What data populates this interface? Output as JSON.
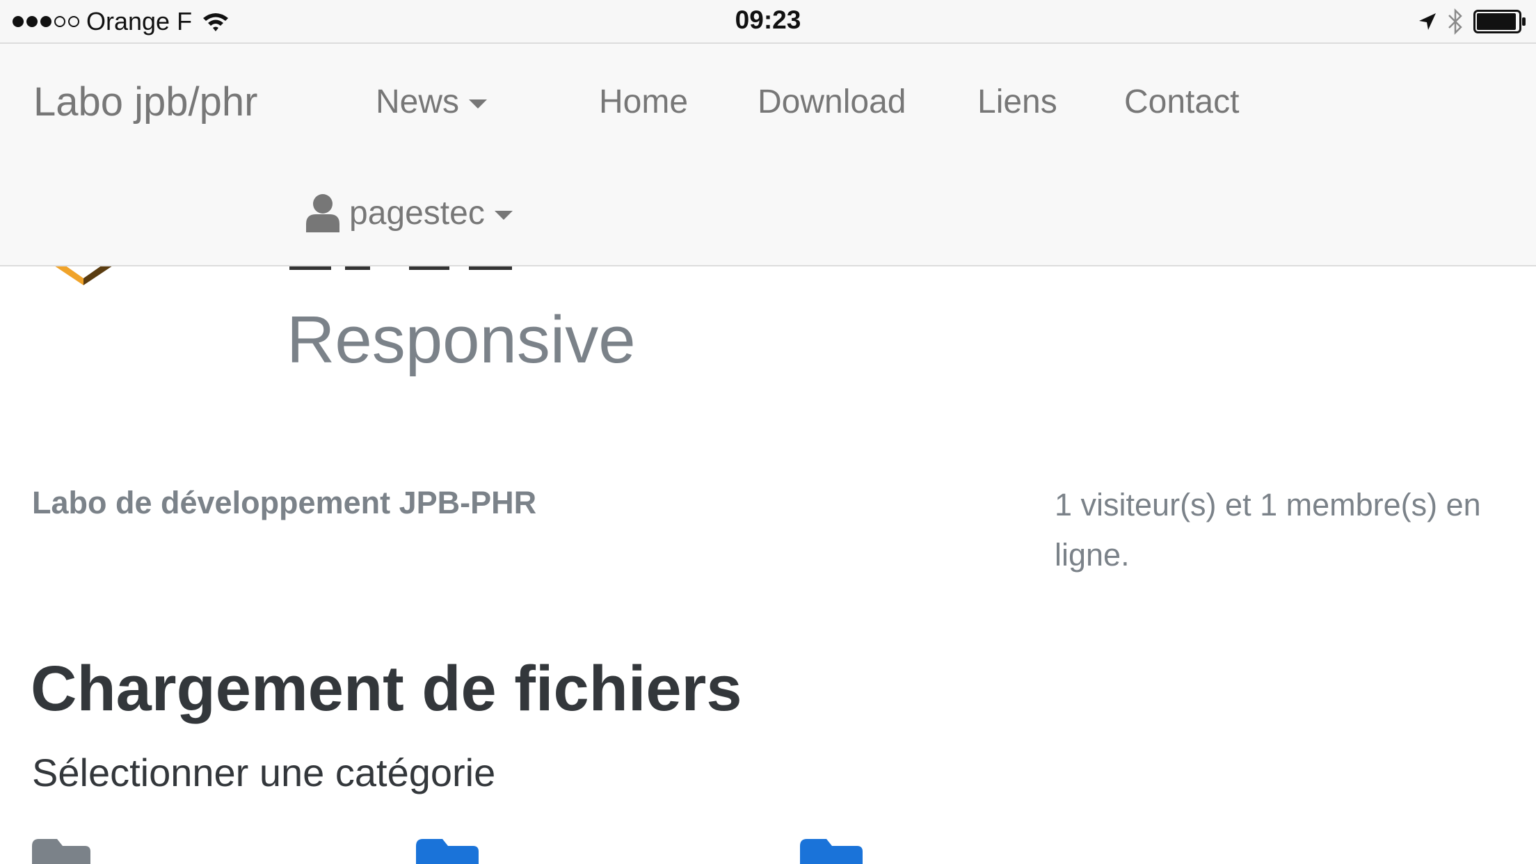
{
  "status_bar": {
    "signal_filled": 3,
    "signal_total": 5,
    "carrier": "Orange F",
    "time": "09:23",
    "icons": [
      "wifi-icon",
      "location-arrow-icon",
      "bluetooth-icon",
      "battery-icon"
    ],
    "battery_level": 0.95
  },
  "navbar": {
    "brand": "Labo jpb/phr",
    "items": [
      {
        "label": "News",
        "dropdown": true
      },
      {
        "label": "Home"
      },
      {
        "label": "Download"
      },
      {
        "label": "Liens"
      },
      {
        "label": "Contact"
      }
    ],
    "user": {
      "label": "pagestec",
      "icon": "user-icon",
      "dropdown": true
    }
  },
  "hero": {
    "subtitle": "Responsive"
  },
  "site": {
    "description": "Labo de développement JPB-PHR",
    "online": "1 visiteur(s) et 1 membre(s) en ligne."
  },
  "main": {
    "title": "Chargement de fichiers",
    "subtitle": "Sélectionner une catégorie"
  },
  "colors": {
    "navbar_bg": "#f8f8f8",
    "nav_text": "#777777",
    "muted_text": "#7b8289",
    "heading_text": "#33373b",
    "folder_gray": "#7b8289",
    "folder_blue": "#1a73d9",
    "logo_orange": "#f0a32a",
    "logo_dark": "#5a3c10"
  }
}
